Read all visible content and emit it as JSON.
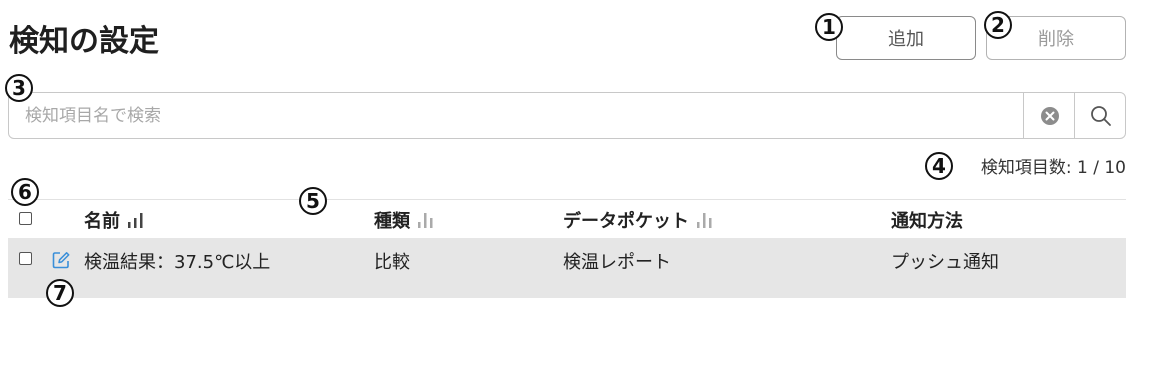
{
  "page": {
    "title": "検知の設定"
  },
  "toolbar": {
    "add_label": "追加",
    "delete_label": "削除"
  },
  "search": {
    "placeholder": "検知項目名で検索",
    "value": ""
  },
  "count": {
    "label": "検知項目数:",
    "value": "1 / 10"
  },
  "annotations": {
    "m1": "1",
    "m2": "2",
    "m3": "3",
    "m4": "4",
    "m5": "5",
    "m6": "6",
    "m7": "7"
  },
  "table": {
    "headers": {
      "name": "名前",
      "type": "種類",
      "pocket": "データポケット",
      "method": "通知方法"
    },
    "rows": [
      {
        "name": "検温結果：37.5℃以上",
        "type": "比較",
        "pocket": "検温レポート",
        "method": "プッシュ通知"
      }
    ]
  },
  "icons": {
    "clear": "clear-circle-icon",
    "search": "search-icon",
    "sort": "sort-bars-icon",
    "edit": "edit-icon"
  },
  "colors": {
    "accent": "#3a8fd9",
    "row_highlight": "#e6e6e6"
  }
}
